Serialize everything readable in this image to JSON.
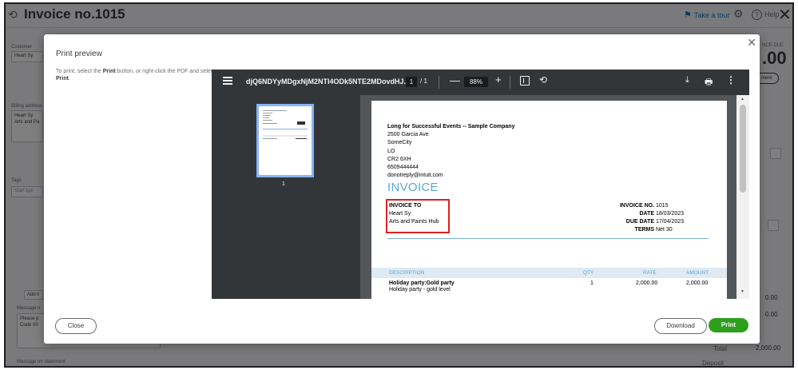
{
  "window": {
    "title": "Invoice no.1015",
    "take_tour": "Take a tour",
    "help": "Help"
  },
  "background": {
    "customer_label": "Customer",
    "customer_value": "Heart Sy",
    "billing_label": "Billing address",
    "billing_value_1": "Heart Sy",
    "billing_value_2": "Arts and Pa",
    "tags_label": "Tags",
    "tags_placeholder": "Start typi",
    "balance_label": "NCE DUE",
    "balance_value": ".00",
    "payment_button": "ment",
    "add_lines": "Add li",
    "message_label": "Message o",
    "message_text_1": "Please p",
    "message_text_2": "Code 00",
    "message_statement_label": "Message on statement",
    "amount_1": "0.00",
    "amount_2": "0.00",
    "amount_3": "0.00",
    "total_label": "Total",
    "total_value": "2,000.00",
    "deposit_label": "Deposit"
  },
  "modal": {
    "title": "Print preview",
    "instruction_pre": "To print, select the ",
    "instruction_print1": "Print",
    "instruction_mid": " button, or right-click the PDF and select ",
    "instruction_print2": "Print",
    "instruction_end": ".",
    "close_button": "Close",
    "download_button": "Download",
    "print_button": "Print"
  },
  "viewer": {
    "file_name": "djQ6NDYyMDgxNjM2NTI4ODk5NTE2MDovdHJ...",
    "current_page": "1",
    "total_pages": "/ 1",
    "zoom": "88%",
    "thumbnail_number": "1"
  },
  "invoice": {
    "company_name": "Long for Successful Events -- Sample Company",
    "address_1": "2500 Garcia Ave",
    "address_2": "SomeCity",
    "address_3": "LO",
    "address_4": "CR2 6XH",
    "phone": "6509444444",
    "email": "donotreply@intuit.com",
    "heading": "INVOICE",
    "bill_to_label": "INVOICE TO",
    "bill_to_name": "Heart Sy",
    "bill_to_company": "Arts and Paints Hub",
    "invoice_no_label": "INVOICE NO.",
    "invoice_no": "1015",
    "date_label": "DATE",
    "date": "18/03/2023",
    "due_date_label": "DUE DATE",
    "due_date": "17/04/2023",
    "terms_label": "TERMS",
    "terms": "Net 30",
    "columns": [
      "DESCRIPTION",
      "QTY",
      "RATE",
      "AMOUNT"
    ],
    "line_item": {
      "name": "Holiday party:Gold party",
      "description": "Holiday party - gold level",
      "qty": "1",
      "rate": "2,000.00",
      "amount": "2,000.00"
    },
    "highlight_color": "#e02020",
    "accent_color": "#5aa6d6"
  }
}
